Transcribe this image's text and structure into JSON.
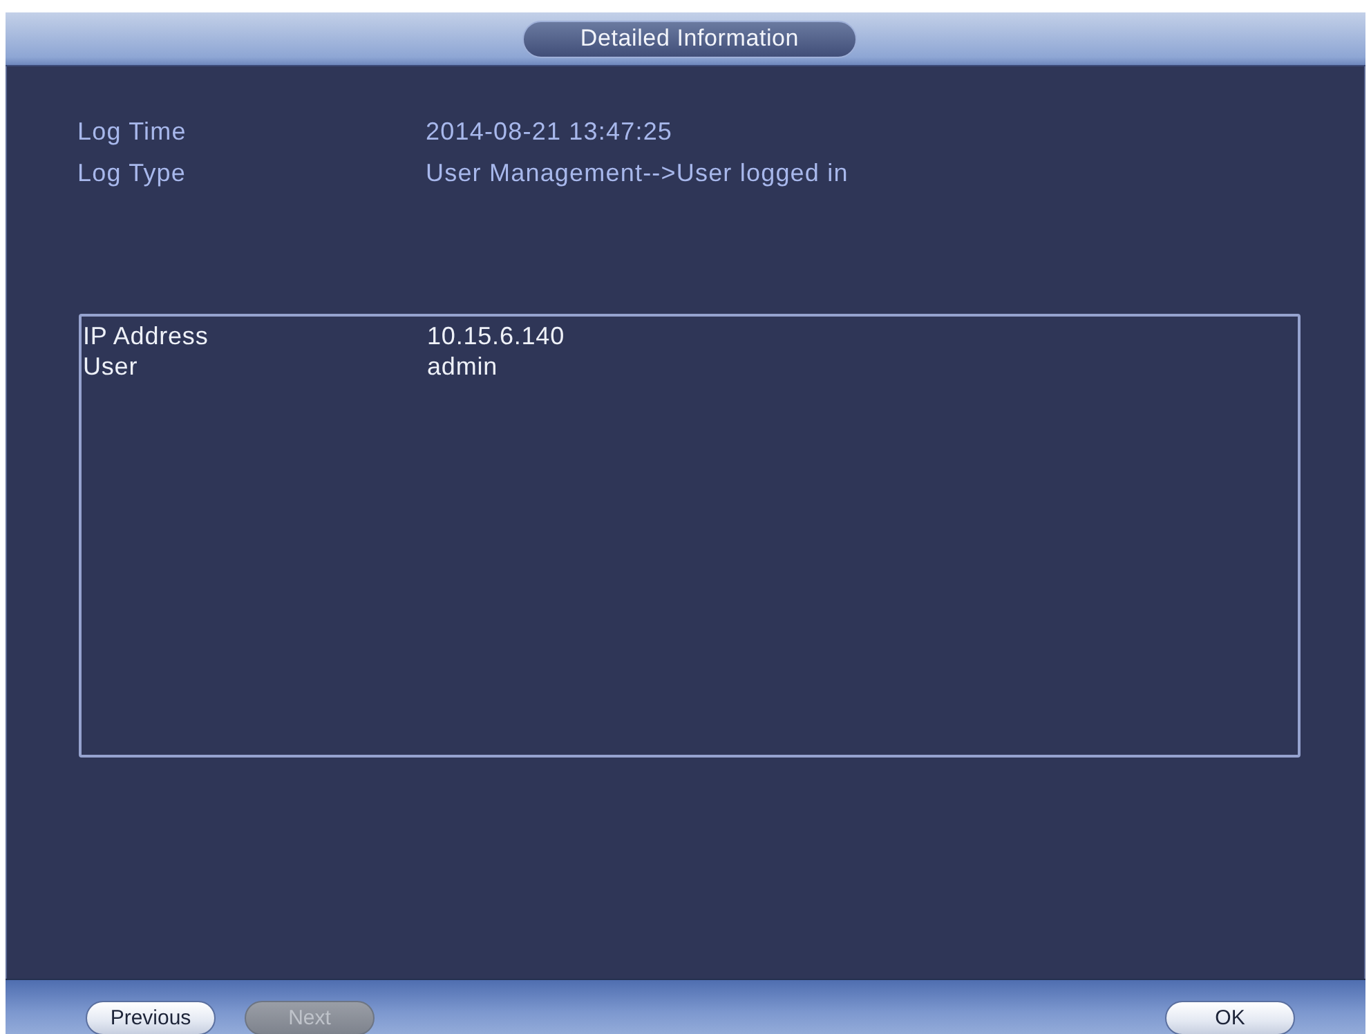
{
  "window": {
    "title": "Detailed Information"
  },
  "fields": [
    {
      "label": "Log Time",
      "value": "2014-08-21 13:47:25"
    },
    {
      "label": "Log Type",
      "value": "User Management-->User logged in"
    }
  ],
  "details": [
    {
      "label": "IP Address",
      "value": "10.15.6.140"
    },
    {
      "label": "User",
      "value": "admin"
    }
  ],
  "footer": {
    "left_buttons": [
      {
        "label": "Previous",
        "disabled": false
      },
      {
        "label": "Next",
        "disabled": true
      }
    ],
    "right_buttons": [
      {
        "label": "OK",
        "disabled": false
      }
    ]
  }
}
